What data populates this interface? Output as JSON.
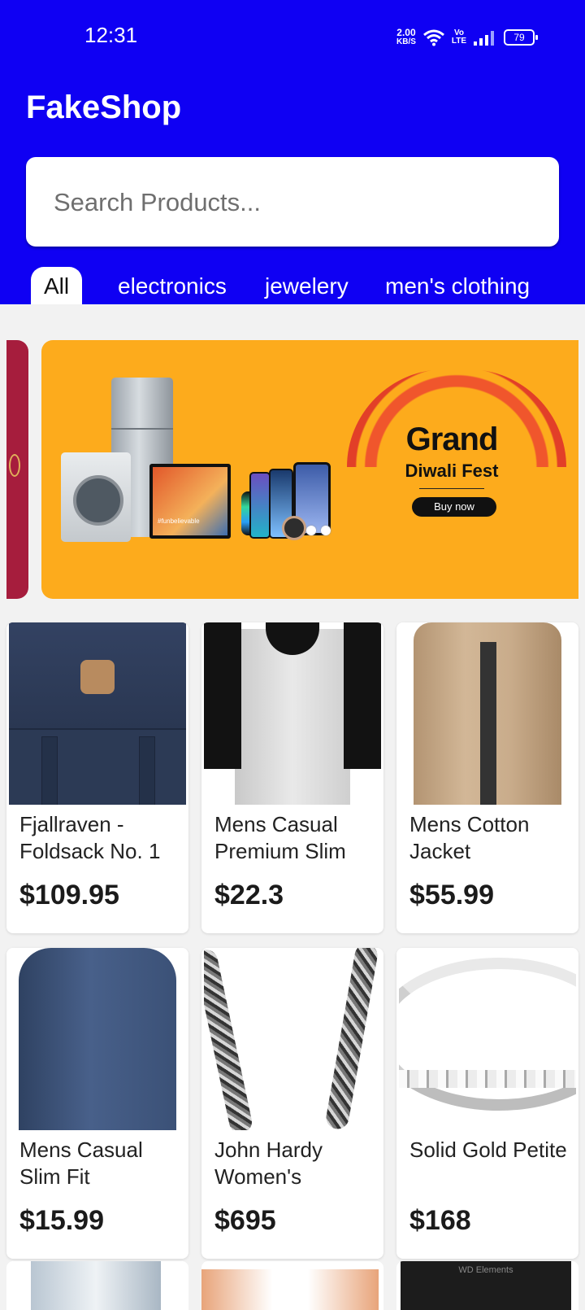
{
  "status_bar": {
    "time": "12:31",
    "net_speed_value": "2.00",
    "net_speed_unit": "KB/S",
    "volte_top": "Vo",
    "volte_bottom": "LTE",
    "battery": "79"
  },
  "app": {
    "title": "FakeShop"
  },
  "search": {
    "placeholder": "Search Products..."
  },
  "categories": [
    "All",
    "electronics",
    "jewelery",
    "men's clothing"
  ],
  "banner": {
    "headline": "Grand",
    "subheadline": "Diwali Fest",
    "cta": "Buy now",
    "tv_caption": "#funbelievable",
    "background": "#fdab1c"
  },
  "products": [
    {
      "title": "Fjallraven - Foldsack No. 1",
      "price": "$109.95"
    },
    {
      "title": "Mens Casual Premium Slim",
      "price": "$22.3"
    },
    {
      "title": "Mens Cotton Jacket",
      "price": "$55.99"
    },
    {
      "title": "Mens Casual Slim Fit",
      "price": "$15.99"
    },
    {
      "title": "John Hardy Women's",
      "price": "$695"
    },
    {
      "title": "Solid Gold Petite",
      "price": "$168"
    }
  ],
  "peek_caption": "WD Elements",
  "colors": {
    "header": "#0f00f3",
    "page_background": "#f2f2f2"
  }
}
